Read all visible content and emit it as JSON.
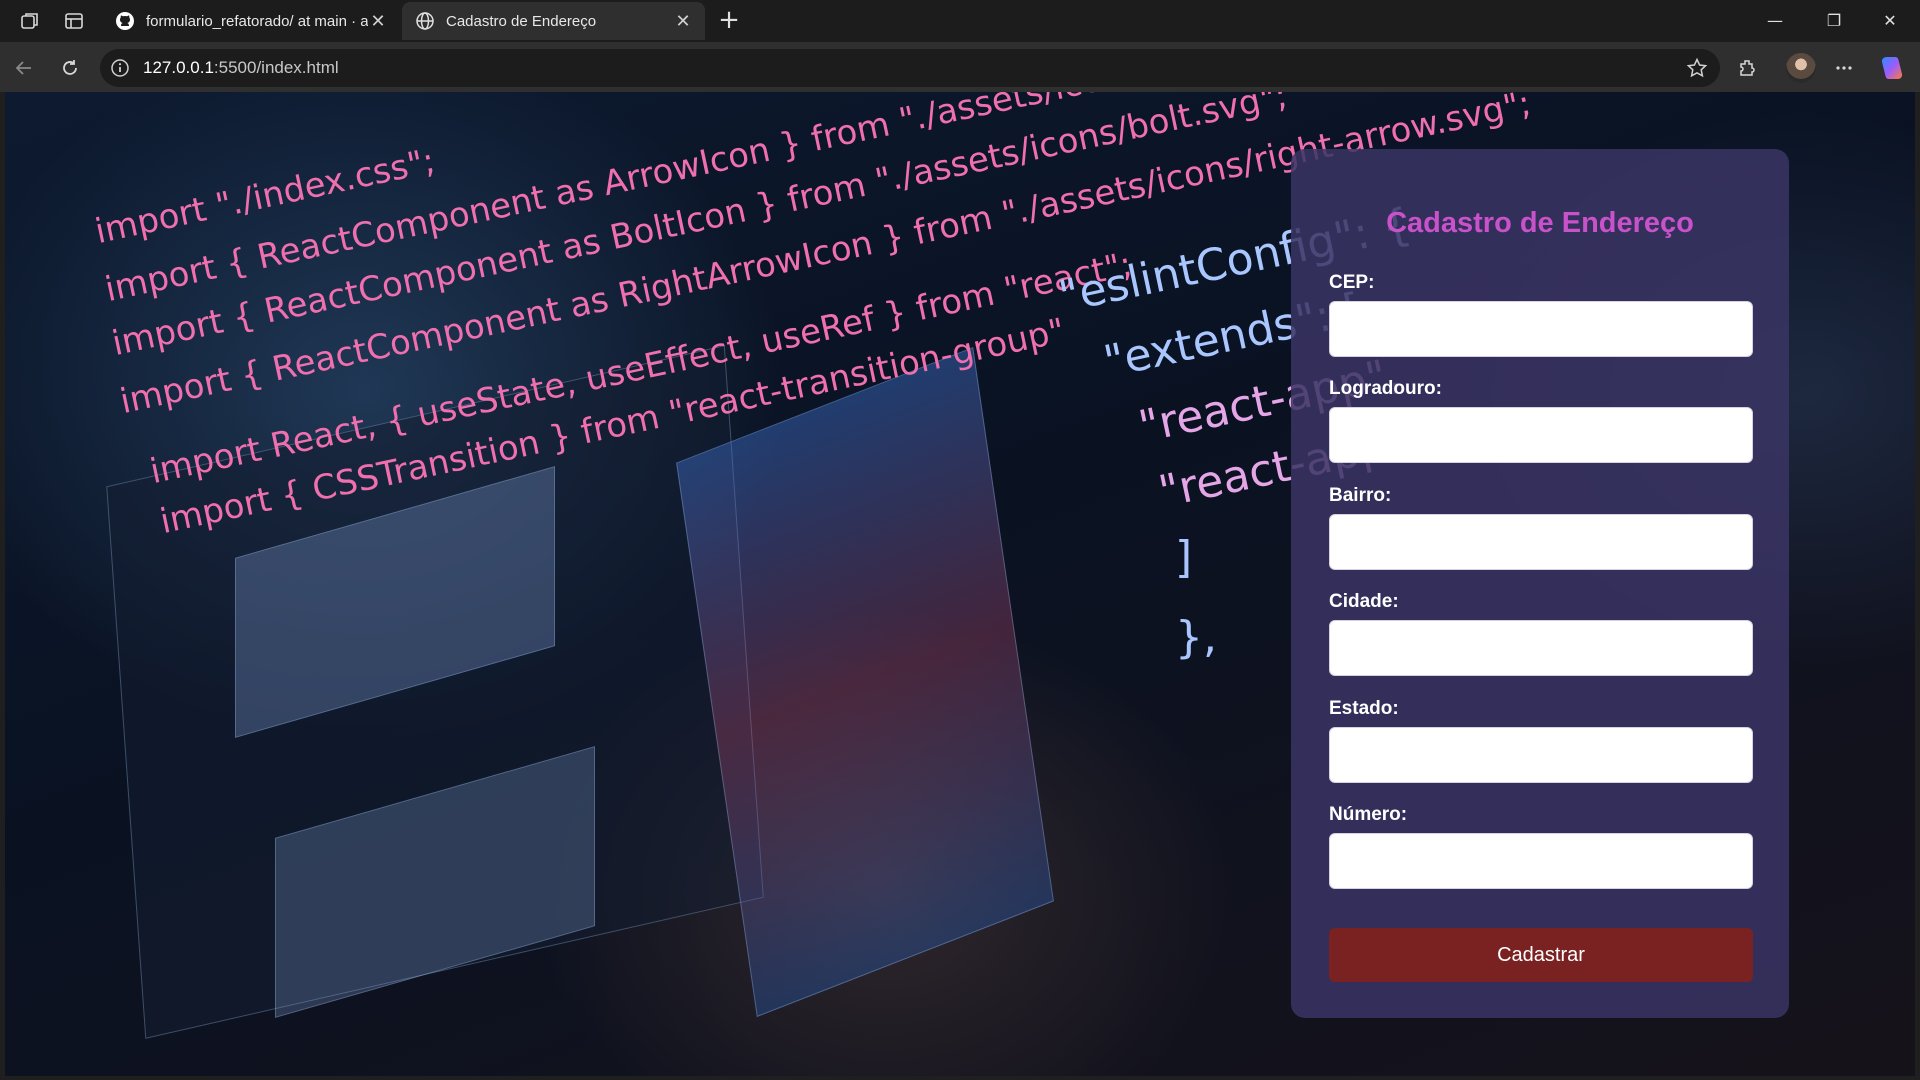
{
  "browser": {
    "tabs": [
      {
        "label": "formulario_refatorado/ at main · a",
        "active": false,
        "icon": "github-icon"
      },
      {
        "label": "Cadastro de Endereço",
        "active": true,
        "icon": "globe-icon"
      }
    ],
    "address": {
      "host": "127.0.0.1",
      "path": ":5500/index.html"
    }
  },
  "background": {
    "code_lines": [
      "import \"./index.css\";",
      "import { ReactComponent as ArrowIcon } from \"./assets/icons/arrow.svg\";",
      "import { ReactComponent as BoltIcon } from \"./assets/icons/bolt.svg\";",
      "import { ReactComponent as RightArrowIcon } from \"./assets/icons/right-arrow.svg\";",
      "import React, { useState, useEffect, useRef } from \"react\";",
      "import { CSSTransition } from \"react-transition-group\"",
      "\"eslintConfig\": {",
      "\"extends\": [",
      "\"react-app\",",
      "\"react-app/",
      "]",
      "},"
    ]
  },
  "form": {
    "title": "Cadastro de Endereço",
    "fields": [
      {
        "label": "CEP:",
        "value": ""
      },
      {
        "label": "Logradouro:",
        "value": ""
      },
      {
        "label": "Bairro:",
        "value": ""
      },
      {
        "label": "Cidade:",
        "value": ""
      },
      {
        "label": "Estado:",
        "value": ""
      },
      {
        "label": "Número:",
        "value": ""
      }
    ],
    "submit_label": "Cadastrar"
  },
  "colors": {
    "title": "#c951c9",
    "button": "#7a2222",
    "panel": "#3a3464"
  }
}
